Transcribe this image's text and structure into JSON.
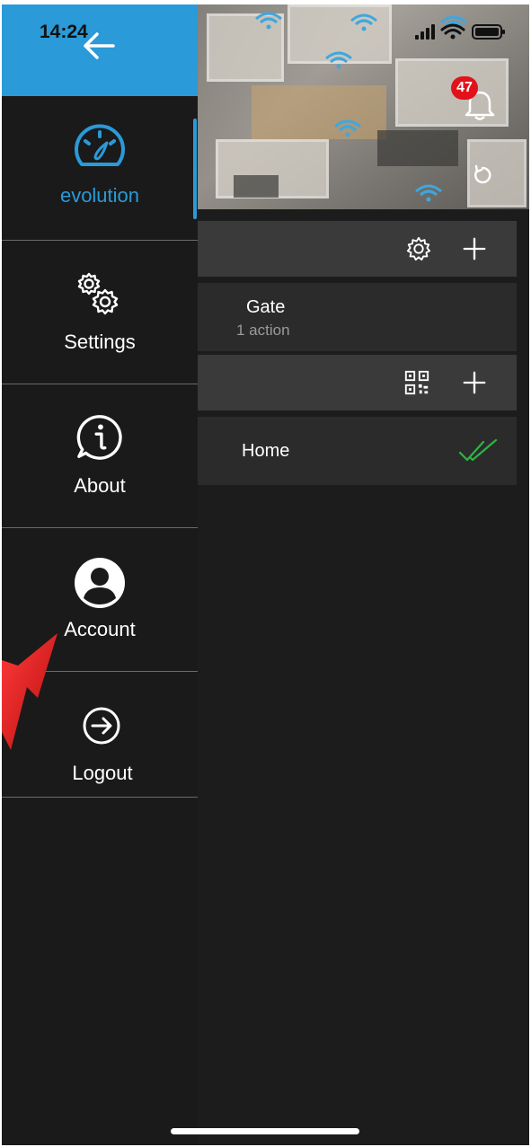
{
  "status_bar": {
    "time": "14:24"
  },
  "header": {
    "notification_count": "47"
  },
  "toolbar_gate": {
    "settings_icon": "gear-icon",
    "add_icon": "plus-icon"
  },
  "gate_row": {
    "title": "Gate",
    "subtitle": "1 action"
  },
  "toolbar_home": {
    "qr_icon": "qr-code-icon",
    "add_icon": "plus-icon"
  },
  "home_row": {
    "title": "Home",
    "status_icon": "double-check-icon",
    "status_color": "#2fb344"
  },
  "drawer": {
    "accent_color": "#2a9ad8",
    "items": [
      {
        "label": "evolution",
        "icon": "speedometer-icon",
        "active": true
      },
      {
        "label": "Settings",
        "icon": "gears-icon"
      },
      {
        "label": "About",
        "icon": "info-icon"
      },
      {
        "label": "Account",
        "icon": "user-icon"
      },
      {
        "label": "Logout",
        "icon": "logout-icon"
      }
    ]
  }
}
